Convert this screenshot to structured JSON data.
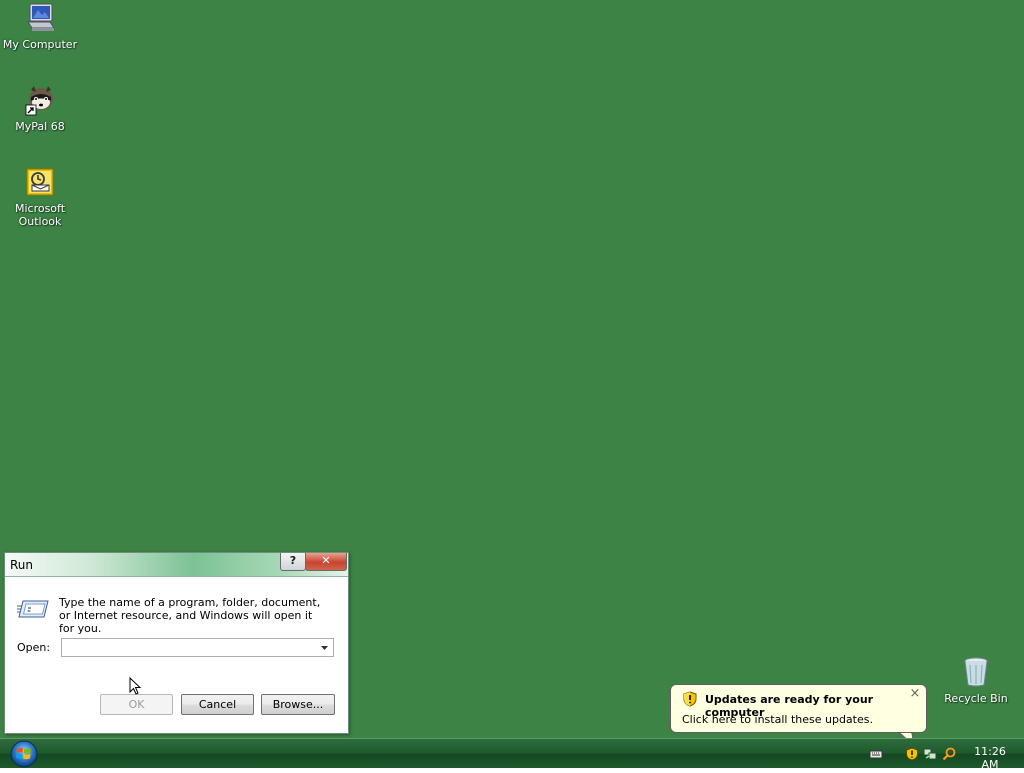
{
  "desktop": {
    "background_color": "#3d8345",
    "icons": [
      {
        "label": "My Computer",
        "icon": "computer-icon"
      },
      {
        "label": "MyPal 68",
        "icon": "mypal-icon"
      },
      {
        "label": "Microsoft Outlook",
        "icon": "outlook-icon"
      },
      {
        "label": "Recycle Bin",
        "icon": "recycle-bin-icon"
      }
    ]
  },
  "run_dialog": {
    "title": "Run",
    "help_glyph": "?",
    "close_glyph": "✕",
    "description": "Type the name of a program, folder, document, or Internet resource, and Windows will open it for you.",
    "open_label": "Open:",
    "open_value": "",
    "ok_label": "OK",
    "cancel_label": "Cancel",
    "browse_label": "Browse..."
  },
  "balloon": {
    "title": "Updates are ready for your computer",
    "text": "Click here to install these updates.",
    "close_glyph": "×",
    "background": "#ffffe1"
  },
  "taskbar": {
    "clock": "11:26 AM",
    "tray_icons": [
      "keyboard-icon",
      "shield-update-icon",
      "network-icon",
      "search-icon"
    ]
  }
}
